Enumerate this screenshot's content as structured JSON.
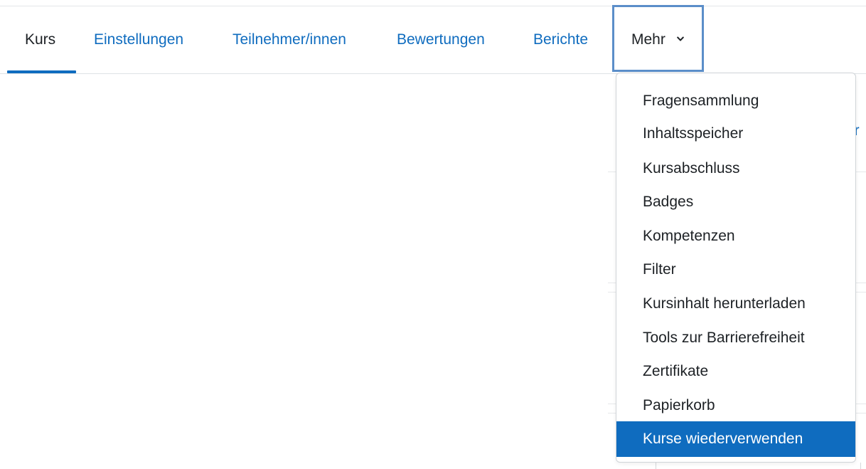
{
  "nav": {
    "tabs": [
      {
        "label": "Kurs",
        "active": true
      },
      {
        "label": "Einstellungen",
        "active": false
      },
      {
        "label": "Teilnehmer/innen",
        "active": false
      },
      {
        "label": "Bewertungen",
        "active": false
      },
      {
        "label": "Berichte",
        "active": false
      }
    ],
    "more": {
      "label": "Mehr",
      "icon": "chevron-down-icon",
      "expanded": true
    }
  },
  "background": {
    "partial_link_text": "er"
  },
  "dropdown": {
    "items": [
      {
        "label": "Fragensammlung"
      },
      {
        "label": "Inhaltsspeicher"
      },
      {
        "label": "Kursabschluss"
      },
      {
        "label": "Badges"
      },
      {
        "label": "Kompetenzen"
      },
      {
        "label": "Filter"
      },
      {
        "label": "Kursinhalt herunterladen"
      },
      {
        "label": "Tools zur Barrierefreiheit"
      },
      {
        "label": "Zertifikate"
      },
      {
        "label": "Papierkorb"
      },
      {
        "label": "Kurse wiederverwenden",
        "selected": true
      }
    ]
  },
  "colors": {
    "link": "#0f6cbf",
    "text": "#1d2125",
    "highlight": "#0f6cbf",
    "focus_border": "#5b8ec9"
  }
}
